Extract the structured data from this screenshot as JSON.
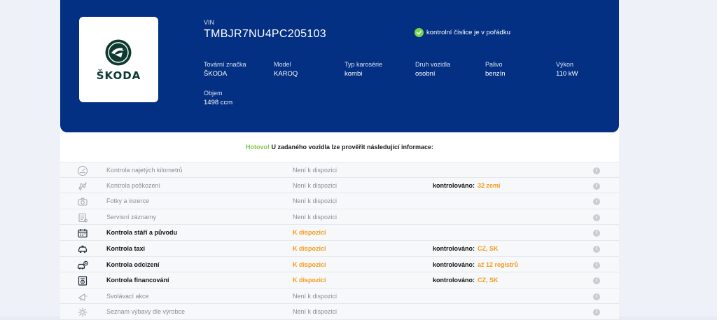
{
  "brand": {
    "logo_text": "ŠKODA",
    "emblem_color": "#0e3a2f"
  },
  "vehicle": {
    "vin_label": "VIN",
    "vin": "TMBJR7NU4PC205103",
    "vin_check": "kontrolní číslice je v pořádku",
    "specs": [
      {
        "label": "Tovární značka",
        "value": "ŠKODA"
      },
      {
        "label": "Model",
        "value": "KAROQ"
      },
      {
        "label": "Typ karosérie",
        "value": "kombi"
      },
      {
        "label": "Druh vozidla",
        "value": "osobní"
      },
      {
        "label": "Palivo",
        "value": "benzín"
      },
      {
        "label": "Výkon",
        "value": "110 kW"
      },
      {
        "label": "Objem",
        "value": "1498 ccm"
      }
    ]
  },
  "heading": {
    "done": "Hotovo!",
    "text": "U zadaného vozidla lze prověřit následující informace:"
  },
  "checks": [
    {
      "icon": "odometer-icon",
      "name": "Kontrola najetých kilometrů",
      "availability": "Není k dispozici",
      "available": false,
      "ctrl_label": "",
      "ctrl_value": ""
    },
    {
      "icon": "damage-icon",
      "name": "Kontrola poškození",
      "availability": "Není k dispozici",
      "available": false,
      "ctrl_label": "kontrolováno:",
      "ctrl_value": "32 zemí"
    },
    {
      "icon": "camera-icon",
      "name": "Fotky a inzerce",
      "availability": "Není k dispozici",
      "available": false,
      "ctrl_label": "",
      "ctrl_value": ""
    },
    {
      "icon": "service-book-icon",
      "name": "Servisní záznamy",
      "availability": "Není k dispozici",
      "available": false,
      "ctrl_label": "",
      "ctrl_value": ""
    },
    {
      "icon": "calendar-icon",
      "name": "Kontrola stáří a původu",
      "availability": "K dispozici",
      "available": true,
      "ctrl_label": "",
      "ctrl_value": ""
    },
    {
      "icon": "taxi-icon",
      "name": "Kontrola taxi",
      "availability": "K dispozici",
      "available": true,
      "ctrl_label": "kontrolováno:",
      "ctrl_value": "CZ, SK"
    },
    {
      "icon": "theft-icon",
      "name": "Kontrola odcizení",
      "availability": "K dispozici",
      "available": true,
      "ctrl_label": "kontrolováno:",
      "ctrl_value": "až 12 registrů"
    },
    {
      "icon": "finance-icon",
      "name": "Kontrola financování",
      "availability": "K dispozici",
      "available": true,
      "ctrl_label": "kontrolováno:",
      "ctrl_value": "CZ, SK"
    },
    {
      "icon": "recall-icon",
      "name": "Svolávací akce",
      "availability": "Není k dispozici",
      "available": false,
      "ctrl_label": "",
      "ctrl_value": ""
    },
    {
      "icon": "equipment-icon",
      "name": "Seznam výbavy dle výrobce",
      "availability": "Není k dispozici",
      "available": false,
      "ctrl_label": "",
      "ctrl_value": ""
    }
  ],
  "info_glyph": "i",
  "colors": {
    "card": "#033083",
    "success": "#78d64b",
    "accent": "#f39a1e"
  }
}
